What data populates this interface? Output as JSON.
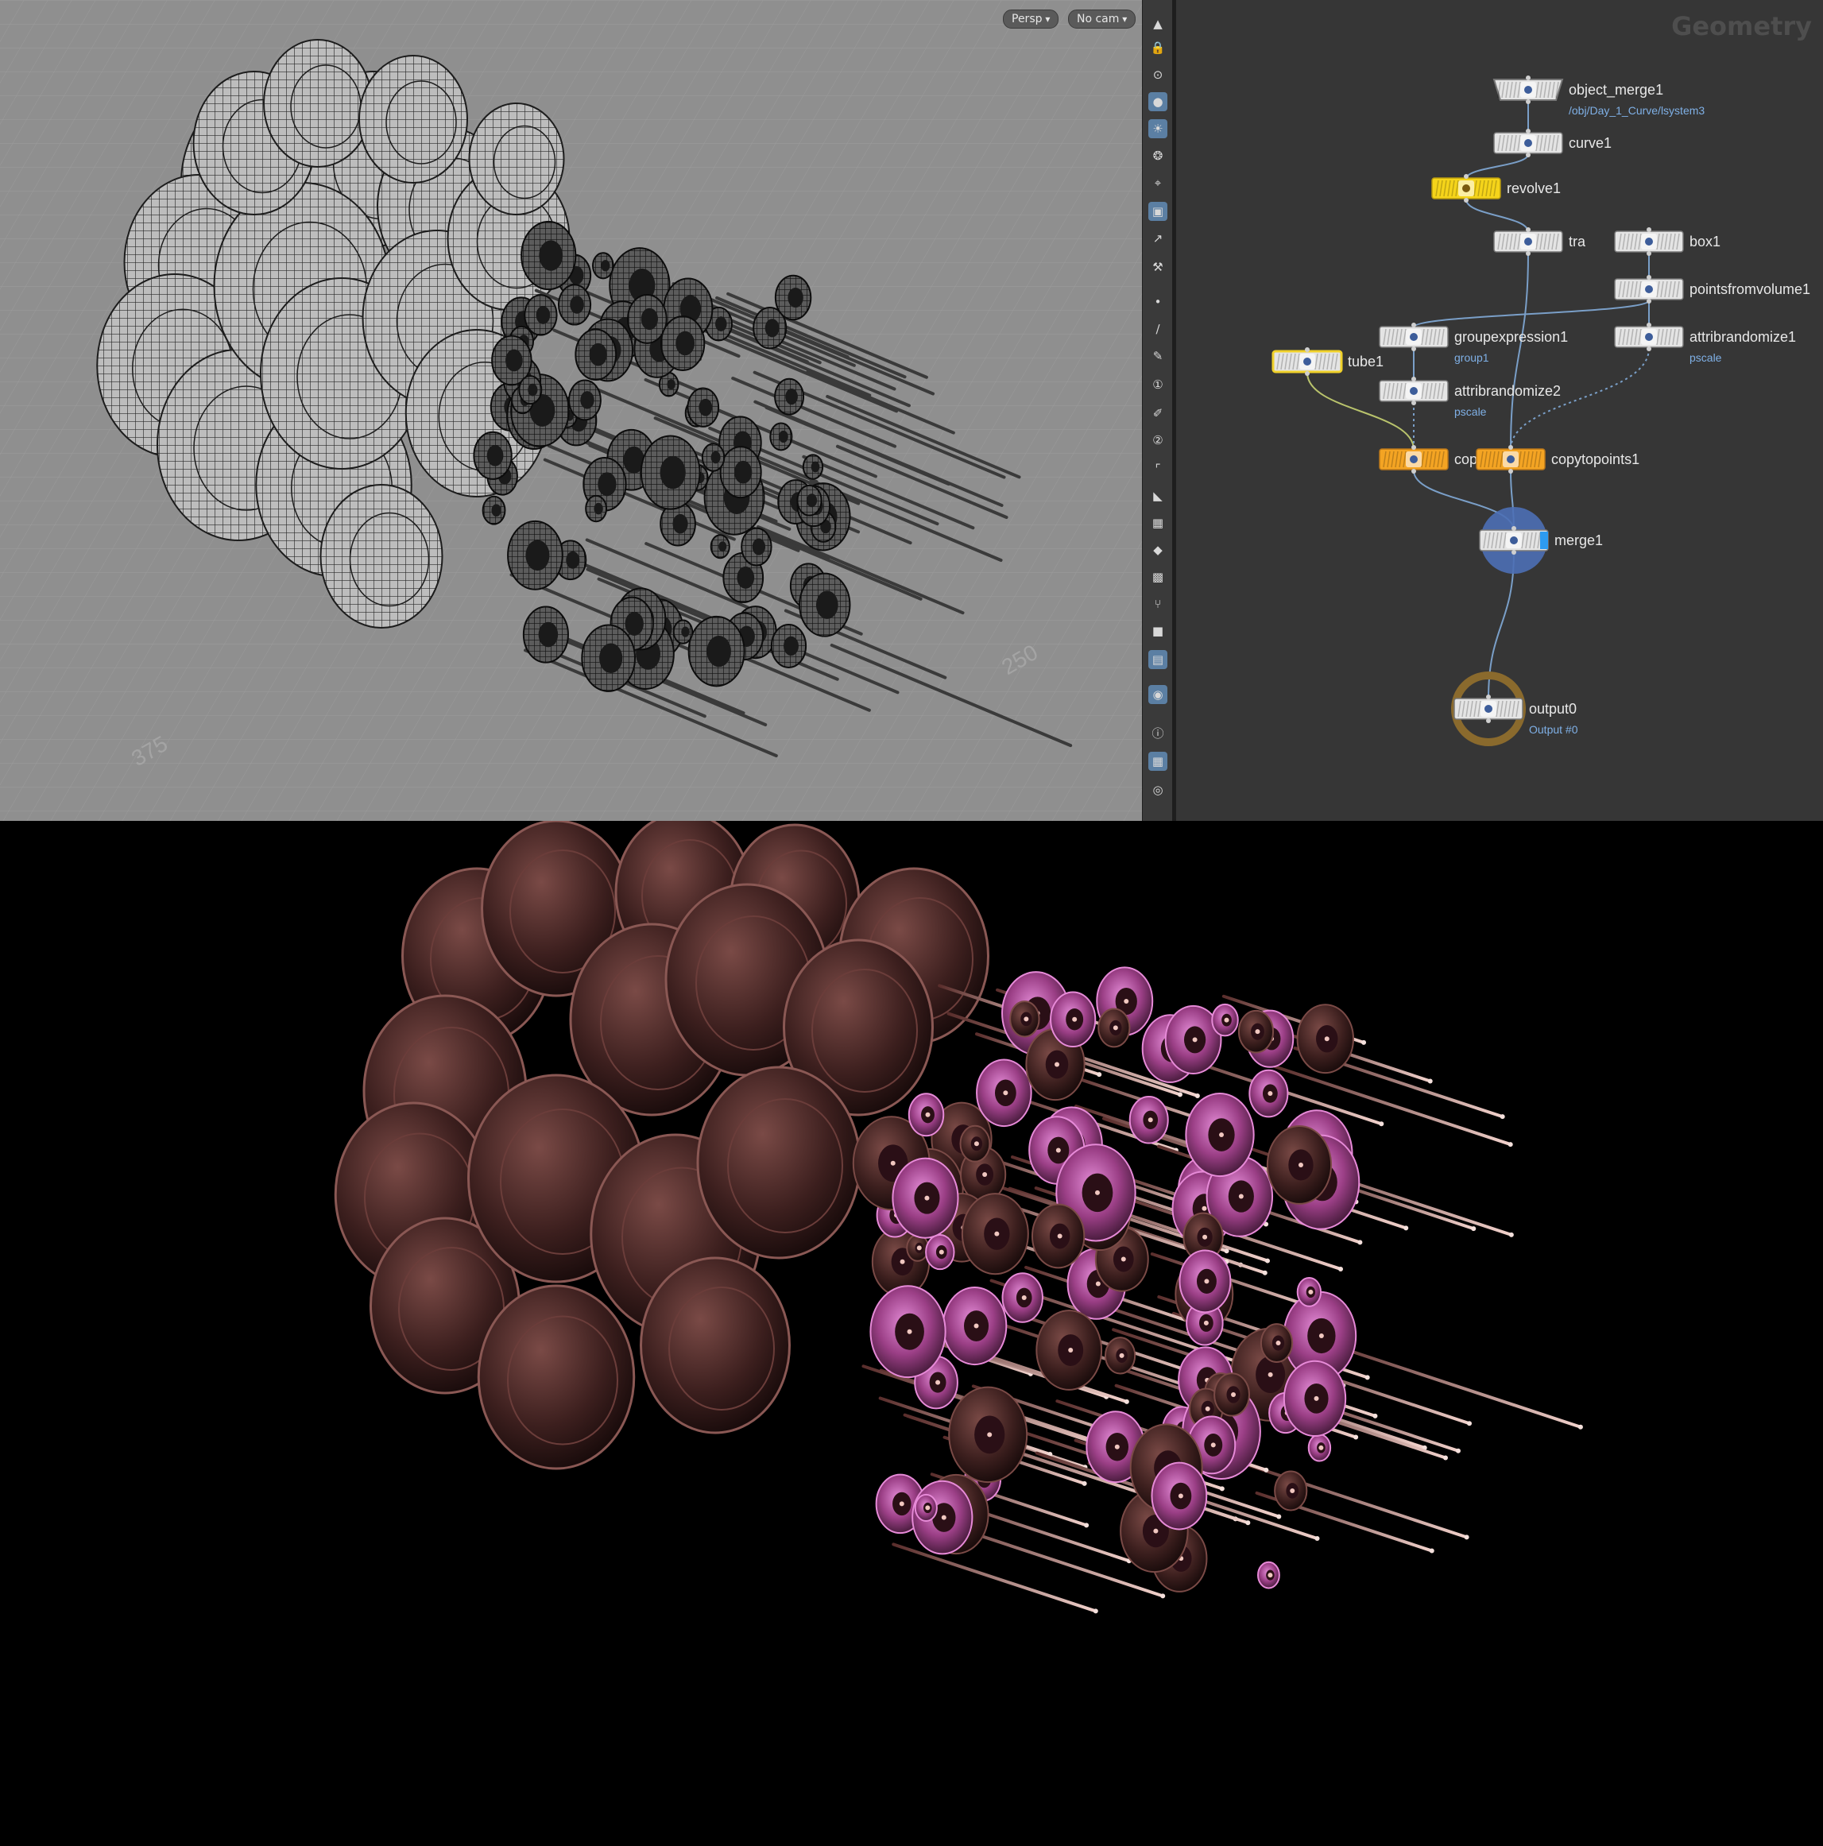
{
  "viewport": {
    "persp_label": "Persp",
    "cam_label": "No cam",
    "grid_labels": [
      "375",
      "250",
      "250"
    ]
  },
  "toolbar": {
    "icons": [
      "arrow-up-icon",
      "lock-icon",
      "display-options-icon",
      "shading-icon",
      "light-icon",
      "light-bulb-icon",
      "light-target-icon",
      "camera-icon",
      "snap-icon",
      "handle-icon",
      "dot-icon",
      "edge-icon",
      "pen-icon",
      "number-icon",
      "brush-icon",
      "number-brush-icon",
      "corner-icon",
      "wing-icon",
      "checker-icon",
      "diamond-icon",
      "texture-icon",
      "fork-icon",
      "stop-icon",
      "image-icon",
      "pin-icon",
      "info-icon",
      "grid-icon",
      "eye-icon"
    ]
  },
  "network": {
    "title": "Geometry",
    "nodes": [
      {
        "id": "object_merge1",
        "label": "object_merge1",
        "sub": "/obj/Day_1_Curve/lsystem3",
        "type": "default"
      },
      {
        "id": "curve1",
        "label": "curve1",
        "sub": "",
        "type": "default"
      },
      {
        "id": "revolve1",
        "label": "revolve1",
        "sub": "",
        "type": "yellow"
      },
      {
        "id": "transform1",
        "label": "tra",
        "sub": "",
        "type": "default"
      },
      {
        "id": "box1",
        "label": "box1",
        "sub": "",
        "type": "default"
      },
      {
        "id": "pointsfromvolume1",
        "label": "pointsfromvolume1",
        "sub": "",
        "type": "default"
      },
      {
        "id": "groupexpression1",
        "label": "groupexpression1",
        "sub": "group1",
        "type": "default"
      },
      {
        "id": "attribrandomize1",
        "label": "attribrandomize1",
        "sub": "pscale",
        "type": "default"
      },
      {
        "id": "tube1",
        "label": "tube1",
        "sub": "",
        "type": "outlined"
      },
      {
        "id": "attribrandomize2",
        "label": "attribrandomize2",
        "sub": "pscale",
        "type": "default"
      },
      {
        "id": "copytopoints2",
        "label": "copytopoints2",
        "sub": "",
        "type": "orange"
      },
      {
        "id": "copytopoints1",
        "label": "copytopoints1",
        "sub": "",
        "type": "orange"
      },
      {
        "id": "merge1",
        "label": "merge1",
        "sub": "",
        "type": "merge"
      },
      {
        "id": "output0",
        "label": "output0",
        "sub": "Output #0",
        "type": "output"
      }
    ]
  },
  "colors": {
    "viewport_bg": "#8f8f8f",
    "network_bg": "#363636",
    "node_yellow": "#f5d41a",
    "node_orange": "#f4a423",
    "wire": "#7a9fc8",
    "render_pink": "#d24bc8",
    "render_brown": "#4a2a28"
  }
}
